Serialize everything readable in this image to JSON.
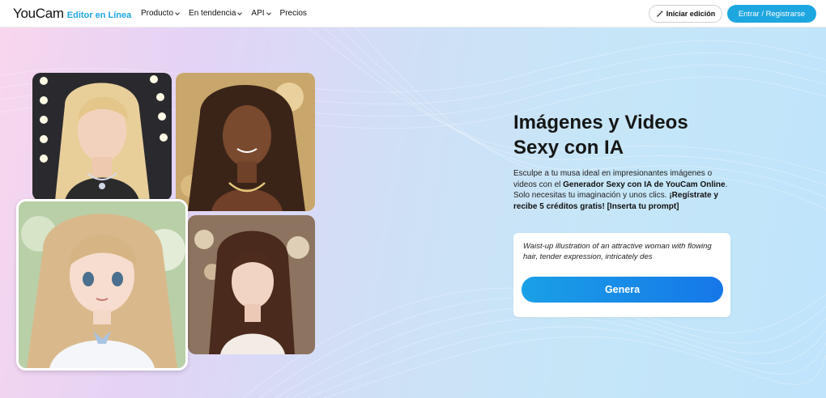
{
  "header": {
    "logo": "YouCam",
    "logo_sub": "Editor en Línea",
    "nav": [
      {
        "label": "Producto"
      },
      {
        "label": "En tendencia"
      },
      {
        "label": "API"
      },
      {
        "label": "Precios"
      }
    ],
    "edit_button": "Iniciar edición",
    "login_button": "Entrar / Registrarse"
  },
  "hero": {
    "title_line1": "Imágenes y Videos",
    "title_line2": "Sexy con IA",
    "desc_part1": "Esculpe a tu musa ideal en impresionantes imágenes o videos con el ",
    "desc_bold1": "Generador Sexy con IA de YouCam Online",
    "desc_part2": ". Solo necesitas tu imaginación y unos clics. ",
    "desc_bold2": "¡Regístrate y recibe 5 créditos gratis! [Inserta tu prompt]",
    "prompt_text": "Waist-up illustration of an attractive woman with flowing hair, tender expression, intricately des",
    "generate_button": "Genera"
  },
  "colors": {
    "accent": "#1ea6e0",
    "button_gradient_start": "#1aa0e6",
    "button_gradient_end": "#1677e8"
  },
  "icons": {
    "edit": "magic-wand-icon"
  }
}
